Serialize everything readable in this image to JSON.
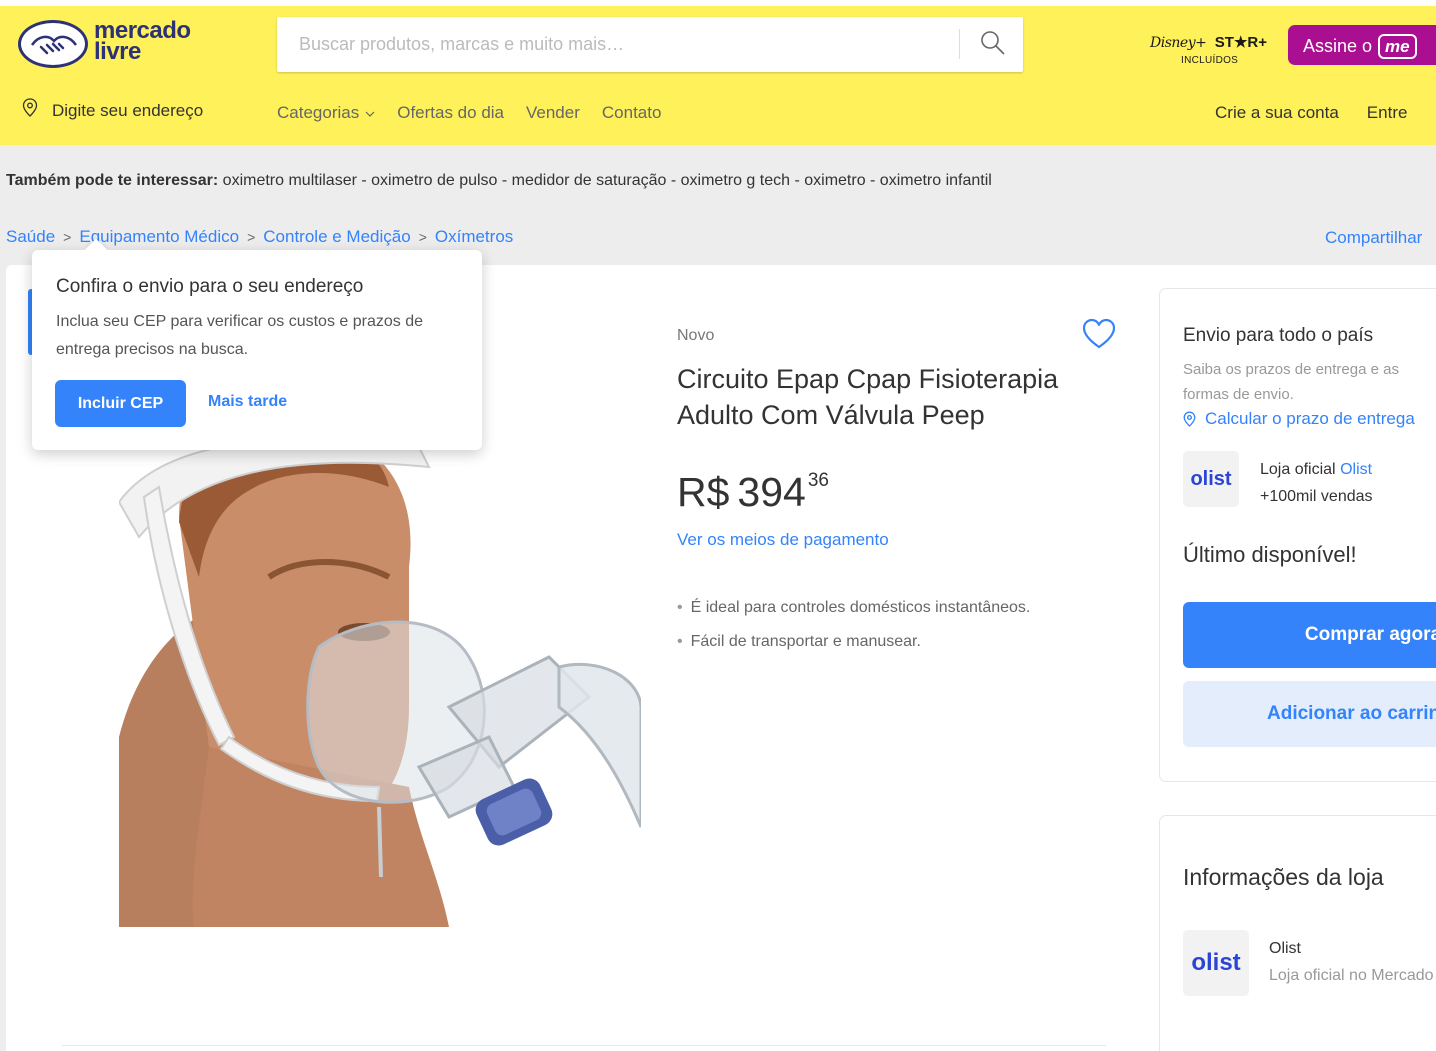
{
  "header": {
    "logo": {
      "line1": "mercado",
      "line2": "livre"
    },
    "search": {
      "placeholder": "Buscar produtos, marcas e muito mais…",
      "icon": "search-icon"
    },
    "promo": {
      "brand": "Disney+",
      "star": "ST★R+",
      "caption": "INCLUÍDOS"
    },
    "subscribe": {
      "label": "Assine o",
      "badge": "me"
    },
    "address": {
      "icon": "location-pin-icon",
      "label": "Digite seu endereço"
    },
    "nav": [
      {
        "label": "Categorias",
        "has_dropdown": true
      },
      {
        "label": "Ofertas do dia"
      },
      {
        "label": "Vender"
      },
      {
        "label": "Contato"
      }
    ],
    "account": {
      "create": "Crie a sua conta",
      "login": "Entre"
    }
  },
  "related": {
    "prefix": "Também pode te interessar:",
    "items": "oximetro multilaser - oximetro de pulso - medidor de saturação - oximetro g tech - oximetro - oximetro infantil"
  },
  "breadcrumb": [
    {
      "label": "Saúde"
    },
    {
      "label": "Equipamento Médico"
    },
    {
      "label": "Controle e Medição"
    },
    {
      "label": "Oxímetros"
    }
  ],
  "share_label": "Compartilhar",
  "product": {
    "condition": "Novo",
    "title": "Circuito Epap Cpap Fisioterapia Adulto Com Válvula Peep",
    "price": {
      "currency": "R$",
      "amount": "394",
      "cents": "36"
    },
    "payment_link": "Ver os meios de pagamento",
    "features": [
      "É ideal para controles domésticos instantâneos.",
      "Fácil de transportar e manusear."
    ]
  },
  "buybox": {
    "shipping_title": "Envio para todo o país",
    "shipping_sub": "Saiba os prazos de entrega e as formas de envio.",
    "calc_link": "Calcular o prazo de entrega",
    "seller_logo": "olist",
    "seller_prefix": "Loja oficial",
    "seller_name": "Olist",
    "seller_sales": "+100mil vendas",
    "stock": "Último disponível!",
    "buy_label": "Comprar agora",
    "cart_label": "Adicionar ao carrinho"
  },
  "store": {
    "title": "Informações da loja",
    "logo": "olist",
    "name": "Olist",
    "desc": "Loja oficial no Mercado Livre"
  },
  "popover": {
    "title": "Confira o envio para o seu endereço",
    "text": "Inclua seu CEP para verificar os custos e prazos de entrega precisos na busca.",
    "primary": "Incluir CEP",
    "secondary": "Mais tarde"
  },
  "colors": {
    "header": "#fff159",
    "accent": "#3483fa",
    "brand_navy": "#2d3277",
    "subscribe": "#a90f90"
  }
}
